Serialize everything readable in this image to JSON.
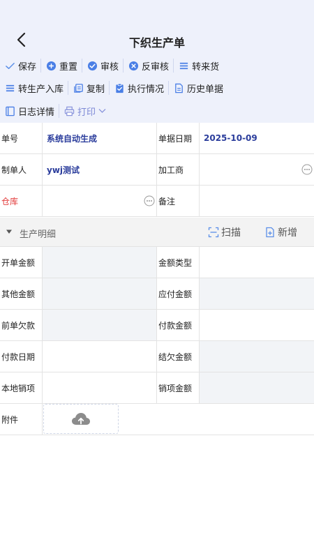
{
  "header": {
    "title": "下织生产单"
  },
  "toolbar": {
    "save": "保存",
    "reset": "重置",
    "audit": "审核",
    "unaudit": "反审核",
    "to_incoming": "转来货",
    "to_stockin": "转生产入库",
    "copy": "复制",
    "exec_status": "执行情况",
    "history": "历史单据",
    "log": "日志详情",
    "print": "打印"
  },
  "form": {
    "order_no_label": "单号",
    "order_no_value": "系统自动生成",
    "date_label": "单据日期",
    "date_value": "2025-10-09",
    "maker_label": "制单人",
    "maker_value": "ywj测试",
    "processor_label": "加工商",
    "processor_value": "",
    "warehouse_label": "仓库",
    "warehouse_value": "",
    "remark_label": "备注",
    "remark_value": ""
  },
  "section": {
    "title": "生产明细",
    "scan": "扫描",
    "add": "新增"
  },
  "amounts": {
    "open_amount_label": "开单金额",
    "amount_type_label": "金额类型",
    "other_amount_label": "其他金额",
    "payable_label": "应付金额",
    "prev_owed_label": "前单欠款",
    "pay_amount_label": "付款金额",
    "pay_date_label": "付款日期",
    "settle_owed_label": "结欠金额",
    "local_writeoff_label": "本地销项",
    "writeoff_amount_label": "销项金额",
    "attachment_label": "附件"
  },
  "colors": {
    "accent": "#5b6fd6",
    "header_bg": "#eef1fb",
    "value_blue": "#2b3d9c",
    "required_red": "#e23a3a"
  }
}
